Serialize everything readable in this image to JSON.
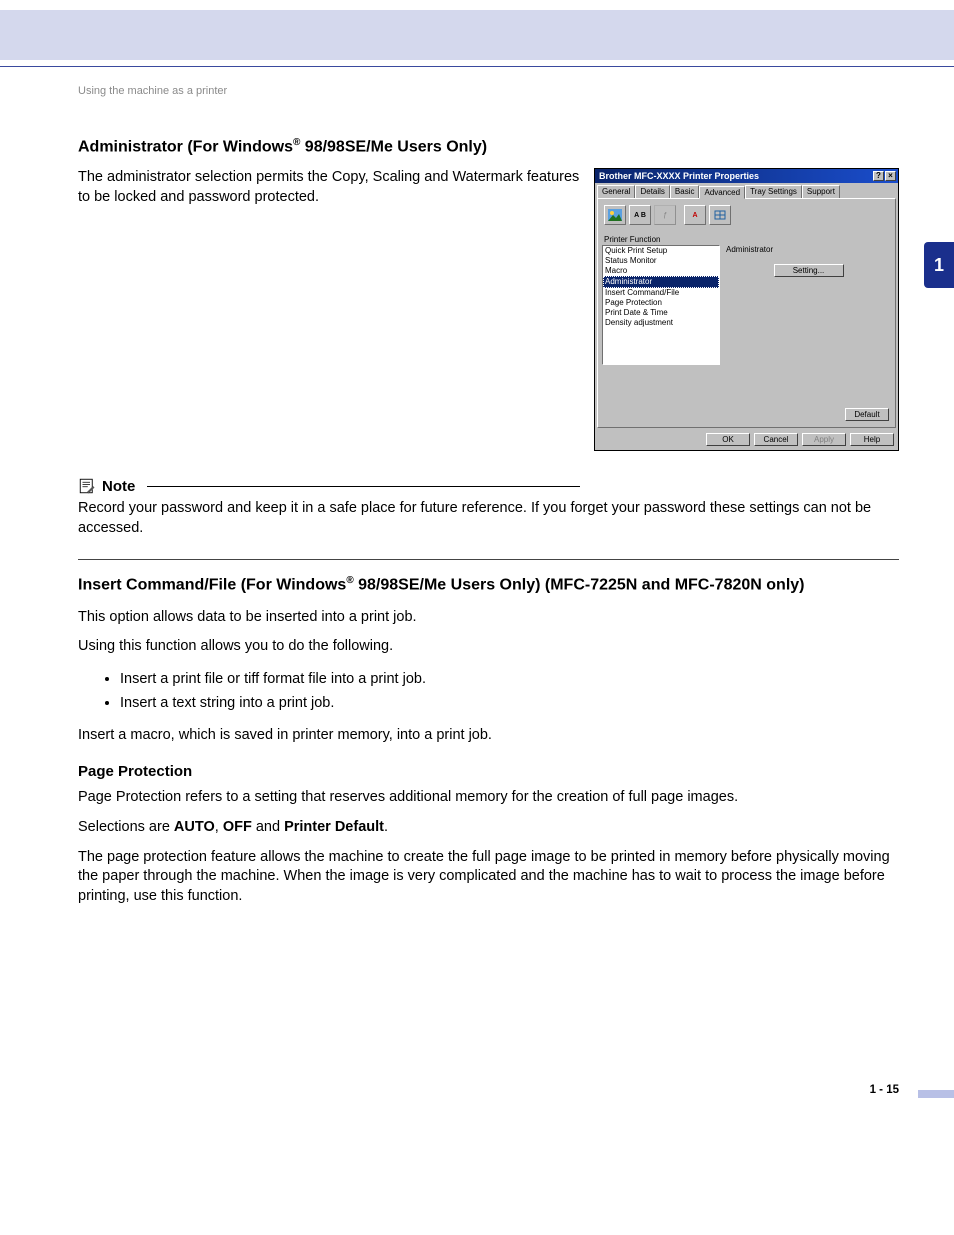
{
  "breadcrumb": "Using the machine as a printer",
  "side_tab": "1",
  "page_number": "1 - 15",
  "admin": {
    "heading_a": "Administrator (For Windows",
    "heading_b": " 98/98SE/Me Users Only)",
    "sup": "®",
    "body": "The administrator selection permits the Copy, Scaling and Watermark features to be locked and password protected."
  },
  "note": {
    "label": "Note",
    "body": "Record your password and keep it in a safe place for future reference. If you forget your password these settings can not be accessed."
  },
  "insert": {
    "heading_a": "Insert Command/File (For Windows",
    "heading_b": " 98/98SE/Me Users Only) (MFC-7225N and MFC-7820N only)",
    "sup": "®",
    "p1": "This option allows data to be inserted into a print job.",
    "p2": "Using this function allows you to do the following.",
    "bullets": [
      "Insert a print file or tiff format file into a print job.",
      "Insert a text string into a print job."
    ],
    "p3": "Insert a macro, which is saved in printer memory, into a print job."
  },
  "pageprot": {
    "heading": "Page Protection",
    "p1": "Page Protection refers to a setting that reserves additional memory for the creation of full page images.",
    "p2a": "Selections are ",
    "b1": "AUTO",
    "sep1": ", ",
    "b2": "OFF",
    "sep2": " and ",
    "b3": "Printer Default",
    "p2b": ".",
    "p3": "The page protection feature allows the machine to create the full page image to be printed in memory before physically moving the paper through the machine. When the image is very complicated and the machine has to wait to process the image before printing, use this function."
  },
  "dialog": {
    "title": "Brother MFC-XXXX Printer Properties",
    "tabs": [
      "General",
      "Details",
      "Basic",
      "Advanced",
      "Tray Settings",
      "Support"
    ],
    "active_tab": "Advanced",
    "pf_label": "Printer Function",
    "right_heading": "Administrator",
    "setting_btn": "Setting...",
    "items": [
      {
        "label": "Quick Print Setup",
        "selected": false
      },
      {
        "label": "Status Monitor",
        "selected": false
      },
      {
        "label": "Macro",
        "selected": false
      },
      {
        "label": "Administrator",
        "selected": true
      },
      {
        "label": "Insert Command/File",
        "selected": false
      },
      {
        "label": "Page Protection",
        "selected": false
      },
      {
        "label": "Print Date & Time",
        "selected": false
      },
      {
        "label": "Density adjustment",
        "selected": false
      }
    ],
    "default_btn": "Default",
    "buttons": {
      "ok": "OK",
      "cancel": "Cancel",
      "apply": "Apply",
      "help": "Help"
    },
    "title_buttons": {
      "help": "?",
      "close": "×"
    }
  }
}
